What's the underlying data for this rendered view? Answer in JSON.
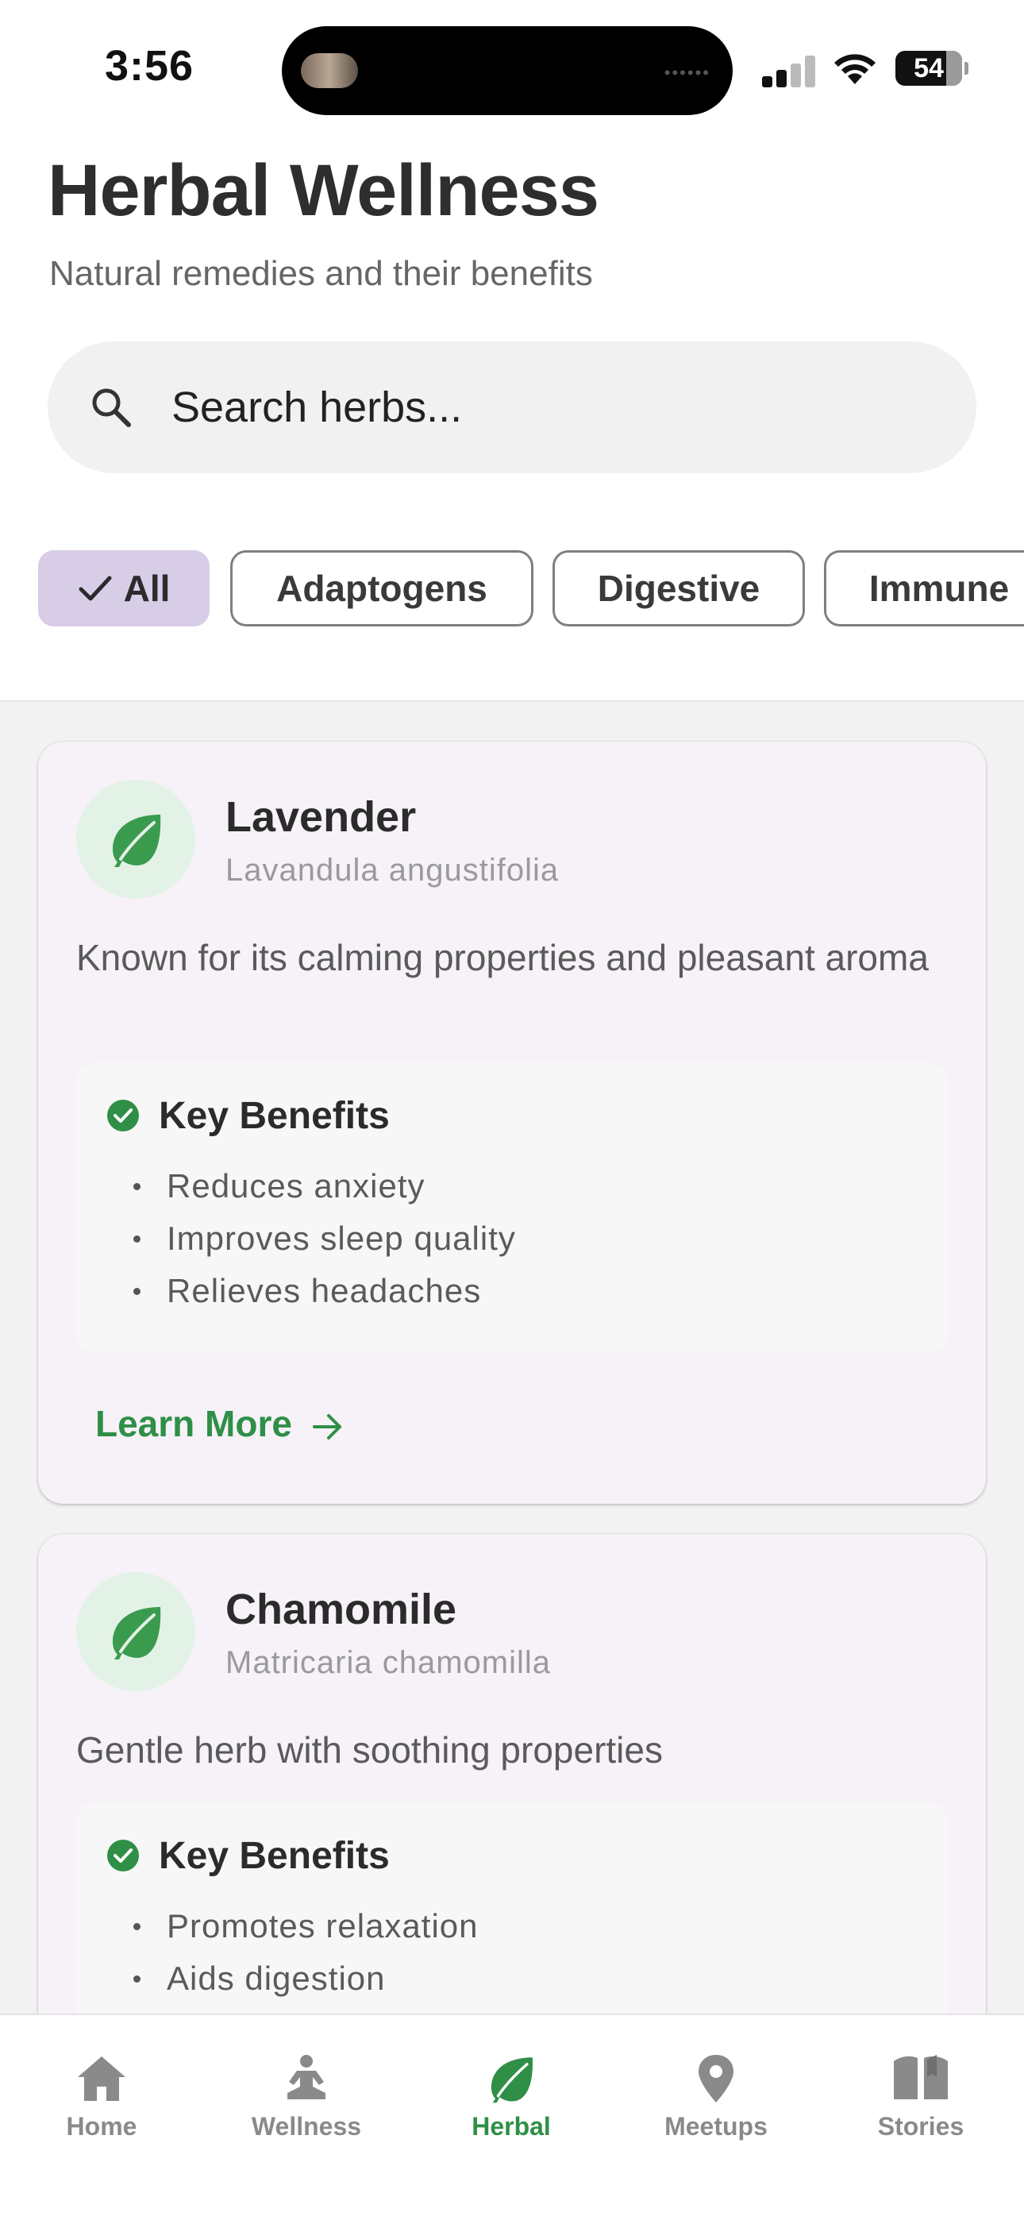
{
  "status_bar": {
    "time": "3:56",
    "battery": "54"
  },
  "header": {
    "title": "Herbal Wellness",
    "subtitle": "Natural remedies and their benefits"
  },
  "search": {
    "placeholder": "Search herbs..."
  },
  "filters": {
    "selected": "All",
    "chips": [
      {
        "label": "All",
        "active": true
      },
      {
        "label": "Adaptogens",
        "active": false
      },
      {
        "label": "Digestive",
        "active": false
      },
      {
        "label": "Immune",
        "active": false
      }
    ]
  },
  "herbs": [
    {
      "name": "Lavender",
      "latin": "Lavandula angustifolia",
      "description": "Known for its calming properties and pleasant aroma",
      "benefits_title": "Key Benefits",
      "benefits": [
        "Reduces anxiety",
        "Improves sleep quality",
        "Relieves headaches"
      ],
      "learn_more": "Learn More"
    },
    {
      "name": "Chamomile",
      "latin": "Matricaria chamomilla",
      "description": "Gentle herb with soothing properties",
      "benefits_title": "Key Benefits",
      "benefits": [
        "Promotes relaxation",
        "Aids digestion"
      ]
    }
  ],
  "nav": {
    "active": "Herbal",
    "items": [
      {
        "label": "Home",
        "icon": "home-icon"
      },
      {
        "label": "Wellness",
        "icon": "meditation-icon"
      },
      {
        "label": "Herbal",
        "icon": "leaf-icon"
      },
      {
        "label": "Meetups",
        "icon": "location-pin-icon"
      },
      {
        "label": "Stories",
        "icon": "book-icon"
      }
    ]
  },
  "colors": {
    "accent_green": "#2f8f46",
    "chip_active": "#d8cde6",
    "card_bg": "#f6f2f8",
    "icon_circle": "#e3f2e6"
  }
}
